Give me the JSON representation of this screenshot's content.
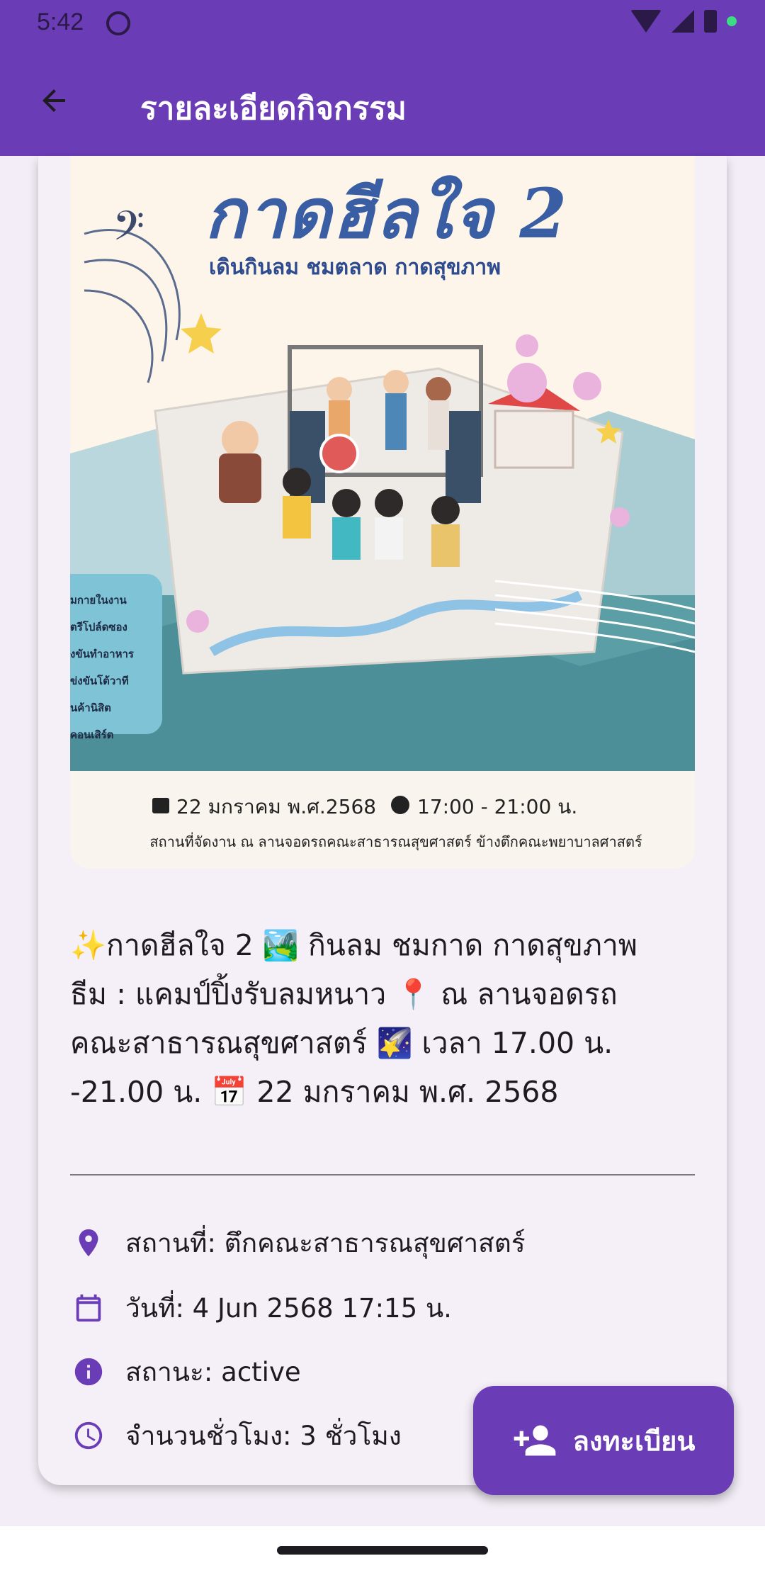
{
  "status_bar": {
    "time": "5:42"
  },
  "app_bar": {
    "title": "รายละเอียดกิจกรรม",
    "back_icon": "arrow-back-icon"
  },
  "poster": {
    "title": "กาดฮีลใจ 2",
    "subtitle": "เดินกินลม ชมตลาด กาดสุขภาพ",
    "side_list": [
      "มกายในงาน",
      "ตรีโปล์ดซอง",
      "งขันทำอาหาร",
      "ข่งขันโต้วาที",
      "นค้านิสิต",
      "คอนเสิร์ต"
    ],
    "date": "22 มกราคม พ.ศ.2568",
    "time": "17:00 - 21:00 น.",
    "venue": "สถานที่จัดงาน ณ ลานจอดรถคณะสาธารณสุขศาสตร์ ข้างตึกคณะพยาบาลศาสตร์"
  },
  "description": {
    "line1": "✨กาดฮีลใจ 2 🏞️ กินลม ชมกาด กาดสุขภาพ",
    "line2": "ธีม : แคมป์ปิ้งรับลมหนาว 📍 ณ ลานจอดรถ",
    "line3": "คณะสาธารณสุขศาสตร์ 🌠 เวลา 17.00 น.",
    "line4": "-21.00 น. 📅 22 มกราคม พ.ศ. 2568"
  },
  "details": {
    "location": "สถานที่: ตึกคณะสาธารณสุขศาสตร์",
    "date": "วันที่: 4 Jun 2568 17:15 น.",
    "status": "สถานะ: active",
    "hours": "จำนวนชั่วโมง: 3 ชั่วโมง"
  },
  "fab": {
    "label": "ลงทะเบียน",
    "icon": "person-add-icon"
  },
  "colors": {
    "primary": "#6a3cb5",
    "icon": "#6a3cb5",
    "card_bg": "#f5eff8",
    "page_bg": "#f2edf6"
  }
}
